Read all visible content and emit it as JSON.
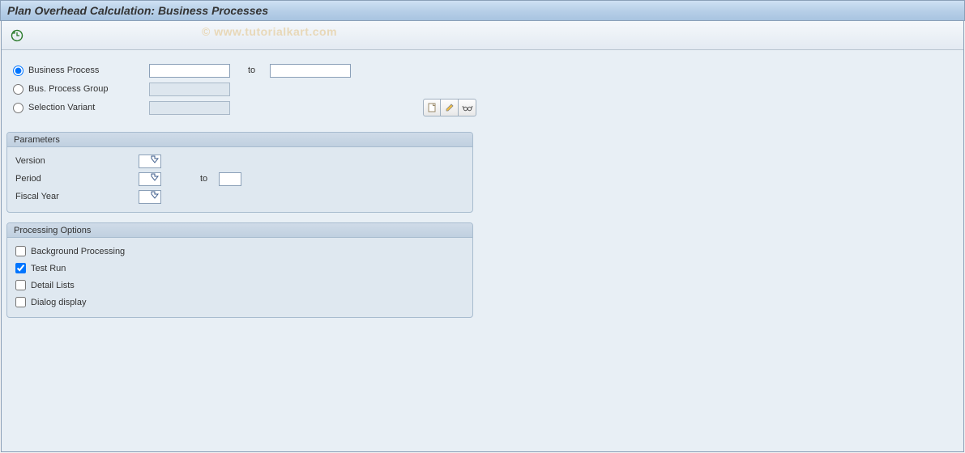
{
  "title": "Plan Overhead Calculation: Business Processes",
  "watermark": "© www.tutorialkart.com",
  "selection": {
    "business_process": {
      "label": "Business Process",
      "from": "",
      "to_label": "to",
      "to": ""
    },
    "bus_process_group": {
      "label": "Bus. Process Group",
      "value": ""
    },
    "selection_variant": {
      "label": "Selection Variant",
      "value": ""
    }
  },
  "parameters": {
    "group_title": "Parameters",
    "version": {
      "label": "Version",
      "value": ""
    },
    "period": {
      "label": "Period",
      "from": "",
      "to_label": "to",
      "to": ""
    },
    "fiscal_year": {
      "label": "Fiscal Year",
      "value": ""
    }
  },
  "processing_options": {
    "group_title": "Processing Options",
    "background_processing": {
      "label": "Background Processing",
      "checked": false
    },
    "test_run": {
      "label": "Test Run",
      "checked": true
    },
    "detail_lists": {
      "label": "Detail Lists",
      "checked": false
    },
    "dialog_display": {
      "label": "Dialog display",
      "checked": false
    }
  }
}
